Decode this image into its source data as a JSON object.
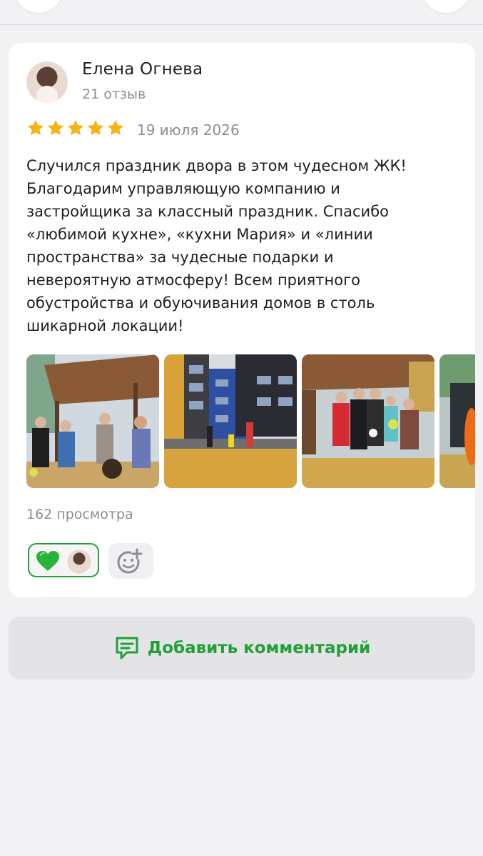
{
  "review": {
    "author_name": "Елена Огнева",
    "author_reviews": "21 отзыв",
    "rating": 5,
    "rating_max": 5,
    "date": "19 июля 2026",
    "text": "Случился праздник двора в этом чудесном ЖК!\nБлагодарим управляющую компанию и\nзастройщика за классный праздник. Спасибо\n«любимой кухне», «кухни Мария» и «линии\nпространства» за чудесные подарки и\nневероятную атмосферу! Всем приятного\nобустройства и обуючивания домов в столь\nшикарной локации!",
    "views": "162 просмотра",
    "photos": [
      {
        "name": "review-photo-1"
      },
      {
        "name": "review-photo-2"
      },
      {
        "name": "review-photo-3"
      },
      {
        "name": "review-photo-4"
      }
    ],
    "reactions": {
      "like_icon": "green-heart-icon",
      "add_icon": "add-reaction-smiley-icon"
    }
  },
  "actions": {
    "add_comment_label": "Добавить комментарий",
    "add_comment_icon": "comment-icon"
  },
  "colors": {
    "accent": "#21a038",
    "star": "#f5b316",
    "secondary_text": "#8d8d92",
    "background": "#f2f2f4"
  }
}
